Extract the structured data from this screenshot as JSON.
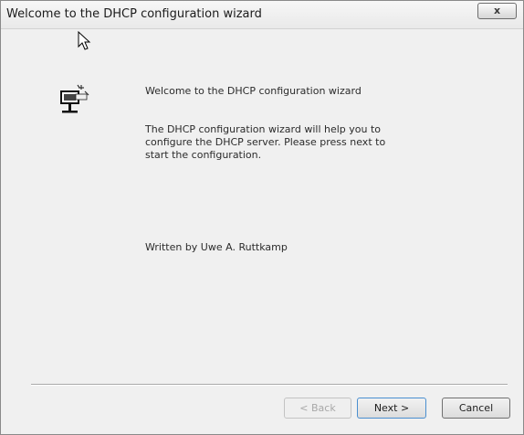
{
  "window": {
    "title": "Welcome to the DHCP configuration wizard",
    "close_label": "x"
  },
  "icons": {
    "app": "network-server-icon",
    "cursor": "mouse-pointer-icon"
  },
  "content": {
    "welcome": "Welcome to the DHCP configuration wizard",
    "description": "The DHCP configuration wizard will help you to configure the DHCP server. Please press next to start the configuration.",
    "author": "Written by Uwe A. Ruttkamp"
  },
  "buttons": {
    "back": "< Back",
    "next": "Next >",
    "cancel": "Cancel"
  }
}
